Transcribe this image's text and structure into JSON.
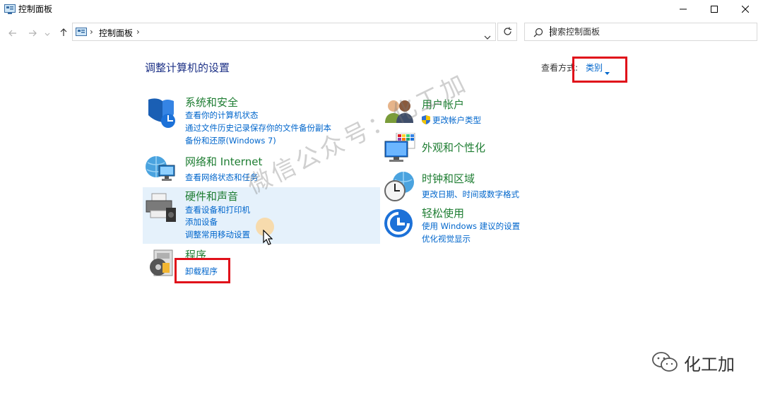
{
  "window": {
    "title": "控制面板"
  },
  "addressbar": {
    "path_item": "控制面板",
    "search_placeholder": "搜索控制面板"
  },
  "header": {
    "title": "调整计算机的设置",
    "view_by_label": "查看方式:",
    "view_by_value": "类别"
  },
  "categories": {
    "system_security": {
      "title": "系统和安全",
      "links": [
        "查看你的计算机状态",
        "通过文件历史记录保存你的文件备份副本",
        "备份和还原(Windows 7)"
      ]
    },
    "network": {
      "title": "网络和 Internet",
      "links": [
        "查看网络状态和任务"
      ]
    },
    "hardware": {
      "title": "硬件和声音",
      "links": [
        "查看设备和打印机",
        "添加设备",
        "调整常用移动设置"
      ]
    },
    "programs": {
      "title": "程序",
      "links": [
        "卸载程序"
      ]
    },
    "user_accounts": {
      "title": "用户帐户",
      "links": [
        "更改帐户类型"
      ]
    },
    "appearance": {
      "title": "外观和个性化",
      "links": []
    },
    "clock_region": {
      "title": "时钟和区域",
      "links": [
        "更改日期、时间或数字格式"
      ]
    },
    "ease_of_access": {
      "title": "轻松使用",
      "links": [
        "使用 Windows 建议的设置",
        "优化视觉显示"
      ]
    }
  },
  "watermark": {
    "text": "微信公众号：化工加",
    "brand": "化工加"
  },
  "colors": {
    "category_title": "#1e7d32",
    "link": "#0066cc",
    "heading": "#1e3287",
    "annotation": "#e0101a",
    "hover": "#e5f1fb"
  }
}
